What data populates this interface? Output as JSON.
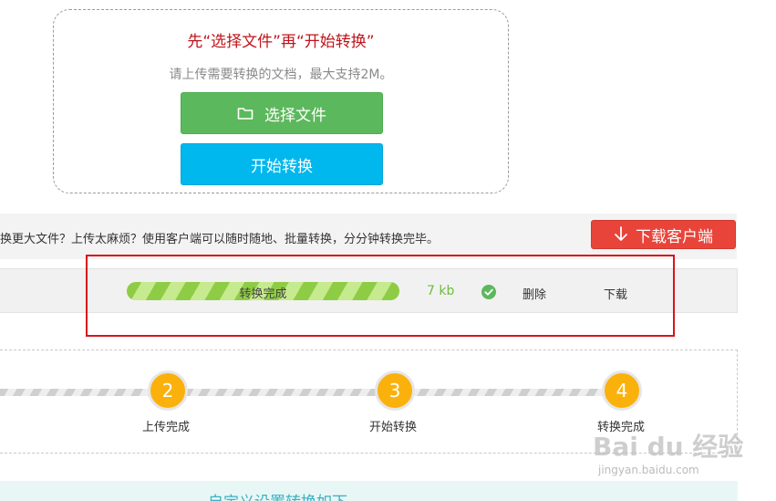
{
  "upload": {
    "heading": "先“选择文件”再“开始转换”",
    "subtitle": "请上传需要转换的文档，最大支持2M。",
    "select_button": "选择文件",
    "convert_button": "开始转换"
  },
  "promo": {
    "text": "换更大文件？上传太麻烦？使用客户端可以随时随地、批量转换，分分钟转换完毕。",
    "download_client": "下载客户端"
  },
  "file_row": {
    "status": "转换完成",
    "progress": 1.0,
    "size": "7 kb",
    "delete": "删除",
    "download": "下载"
  },
  "steps": [
    {
      "number": "2",
      "label": "上传完成"
    },
    {
      "number": "3",
      "label": "开始转换"
    },
    {
      "number": "4",
      "label": "转换完成"
    }
  ],
  "settings": {
    "heading": "自定义设置转换如下"
  },
  "watermark": {
    "main": "Bai du 经验",
    "sub": "jingyan.baidu.com"
  },
  "colors": {
    "accent_red": "#c0141b",
    "green": "#5cb85c",
    "blue": "#00b7ee",
    "orange": "#fbb10c",
    "download_red": "#e8443a"
  }
}
